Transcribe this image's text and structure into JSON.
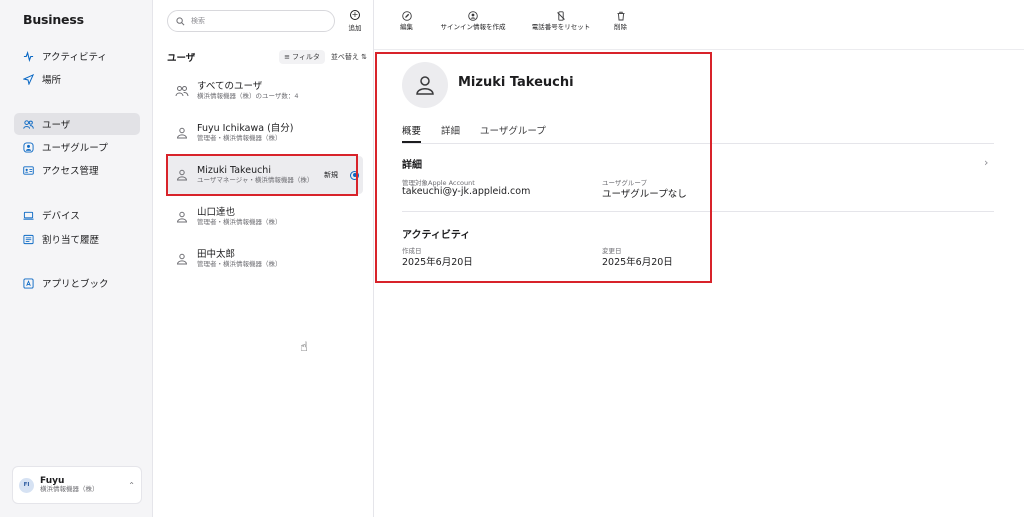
{
  "sidebar": {
    "brand": "Business",
    "items": [
      {
        "label": "アクティビティ",
        "icon": "activity-icon"
      },
      {
        "label": "場所",
        "icon": "location-arrow-icon"
      },
      {
        "label": "ユーザ",
        "icon": "users-icon"
      },
      {
        "label": "ユーザグループ",
        "icon": "user-group-icon"
      },
      {
        "label": "アクセス管理",
        "icon": "id-card-icon"
      },
      {
        "label": "デバイス",
        "icon": "laptop-icon"
      },
      {
        "label": "割り当て履歴",
        "icon": "history-list-icon"
      },
      {
        "label": "アプリとブック",
        "icon": "app-store-icon"
      }
    ],
    "active": "ユーザ",
    "account": {
      "initials": "FI",
      "name": "Fuyu",
      "org": "横浜情報機器（株）"
    }
  },
  "userlist": {
    "search_placeholder": "検索",
    "add_label": "追加",
    "title": "ユーザ",
    "filter_label": "フィルタ",
    "sort_label": "並べ替え ⇅",
    "rows": [
      {
        "name": "すべてのユーザ",
        "sub": "横浜情報機器（株）のユーザ数：4"
      },
      {
        "name": "Fuyu Ichikawa (自分)",
        "sub": "管理者・横浜情報機器（株）"
      },
      {
        "name": "Mizuki Takeuchi",
        "sub": "ユーザマネージャ・横浜情報機器（株）",
        "badge": "新規"
      },
      {
        "name": "山口達也",
        "sub": "管理者・横浜情報機器（株）"
      },
      {
        "name": "田中太郎",
        "sub": "管理者・横浜情報機器（株）"
      }
    ]
  },
  "toolbar": {
    "edit": "編集",
    "create_signin": "サインイン情報を作成",
    "reset_phone": "電話番号をリセット",
    "delete": "削除"
  },
  "detail": {
    "name": "Mizuki Takeuchi",
    "tabs": [
      "概要",
      "詳細",
      "ユーザグループ"
    ],
    "active_tab": "概要",
    "details_title": "詳細",
    "managed_account_label": "管理対象Apple Account",
    "managed_account_value": "takeuchi@y-jk.appleid.com",
    "user_group_label": "ユーザグループ",
    "user_group_value": "ユーザグループなし",
    "activity_title": "アクティビティ",
    "created_label": "作成日",
    "created_value": "2025年6月20日",
    "modified_label": "変更日",
    "modified_value": "2025年6月20日"
  },
  "colors": {
    "accent": "#0a68c4",
    "highlight": "#d8232a"
  }
}
